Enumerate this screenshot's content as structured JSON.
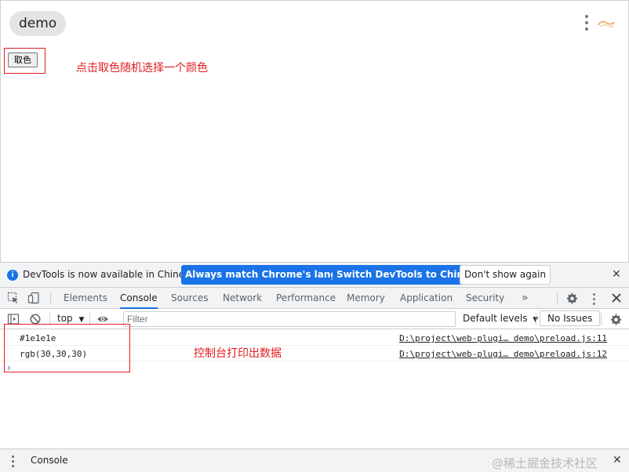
{
  "page": {
    "tab_title": "demo",
    "pick_button_label": "取色",
    "annotation_pick": "点击取色随机选择一个颜色"
  },
  "devtools": {
    "infobar": {
      "message": "DevTools is now available in Chinese!",
      "btn_match": "Always match Chrome's language",
      "btn_switch": "Switch DevTools to Chinese",
      "btn_dismiss": "Don't show again",
      "close": "✕"
    },
    "tabs": [
      "Elements",
      "Console",
      "Sources",
      "Network",
      "Performance",
      "Memory",
      "Application",
      "Security"
    ],
    "more_tabs": "»",
    "toolbar": {
      "context": "top",
      "filter_placeholder": "Filter",
      "levels": "Default levels",
      "issues": "No Issues"
    },
    "console": {
      "rows": [
        {
          "message": "#1e1e1e",
          "source": "D:\\project\\web-plugi… demo\\preload.js:11"
        },
        {
          "message": "rgb(30,30,30)",
          "source": "D:\\project\\web-plugi… demo\\preload.js:12"
        }
      ],
      "prompt": "›",
      "annotation": "控制台打印出数据"
    },
    "drawer": {
      "tab_label": "Console",
      "watermark": "@稀土掘金技术社区",
      "close": "✕"
    }
  },
  "colors": {
    "accent": "#1a73e8",
    "annotation_red": "#e21c1c",
    "toolbar_bg": "#f1f3f4"
  },
  "icons": [
    "more-vert-icon",
    "extension-icon",
    "info-icon",
    "inspect-icon",
    "device-toggle-icon",
    "settings-icon",
    "close-icon",
    "sidebar-toggle-icon",
    "clear-icon",
    "eye-icon",
    "dropdown-icon"
  ]
}
